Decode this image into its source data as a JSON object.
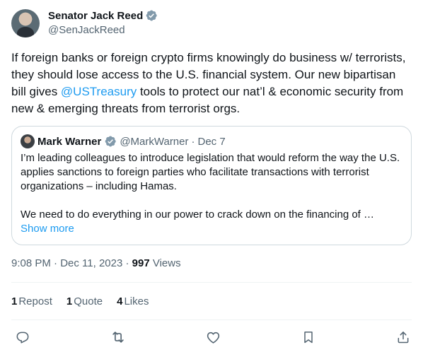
{
  "author": {
    "display_name": "Senator Jack Reed",
    "handle": "@SenJackReed"
  },
  "tweet": {
    "text_before": "If foreign banks or foreign crypto firms knowingly do business w/ terrorists, they should lose access to the U.S. financial system. Our new bipartisan bill gives ",
    "mention": "@USTreasury",
    "text_after": " tools to protect our nat’l & economic security from new & emerging threats from terrorist orgs."
  },
  "quote": {
    "display_name": "Mark Warner",
    "handle": "@MarkWarner",
    "separator": "·",
    "date": "Dec 7",
    "para1": "I’m leading colleagues to introduce legislation that would reform the way the U.S. applies sanctions to foreign parties who facilitate transactions with terrorist organizations – including Hamas.",
    "para2": "We need to do everything in our power to crack down on the financing of …",
    "show_more": "Show more"
  },
  "meta": {
    "time_date": "9:08 PM · Dec 11, 2023 · ",
    "views_count": "997",
    "views_label": " Views"
  },
  "stats": {
    "reposts_count": "1",
    "reposts_label": "Repost",
    "quotes_count": "1",
    "quotes_label": "Quote",
    "likes_count": "4",
    "likes_label": "Likes"
  },
  "icons": {
    "reply": "reply-icon",
    "repost": "repost-icon",
    "like": "heart-icon",
    "bookmark": "bookmark-icon",
    "share": "share-icon",
    "verified": "verified-badge-icon"
  },
  "colors": {
    "accent": "#1d9bf0",
    "text_primary": "#0f1419",
    "text_secondary": "#536471",
    "border": "#cfd9de",
    "verified": "#829aab"
  }
}
